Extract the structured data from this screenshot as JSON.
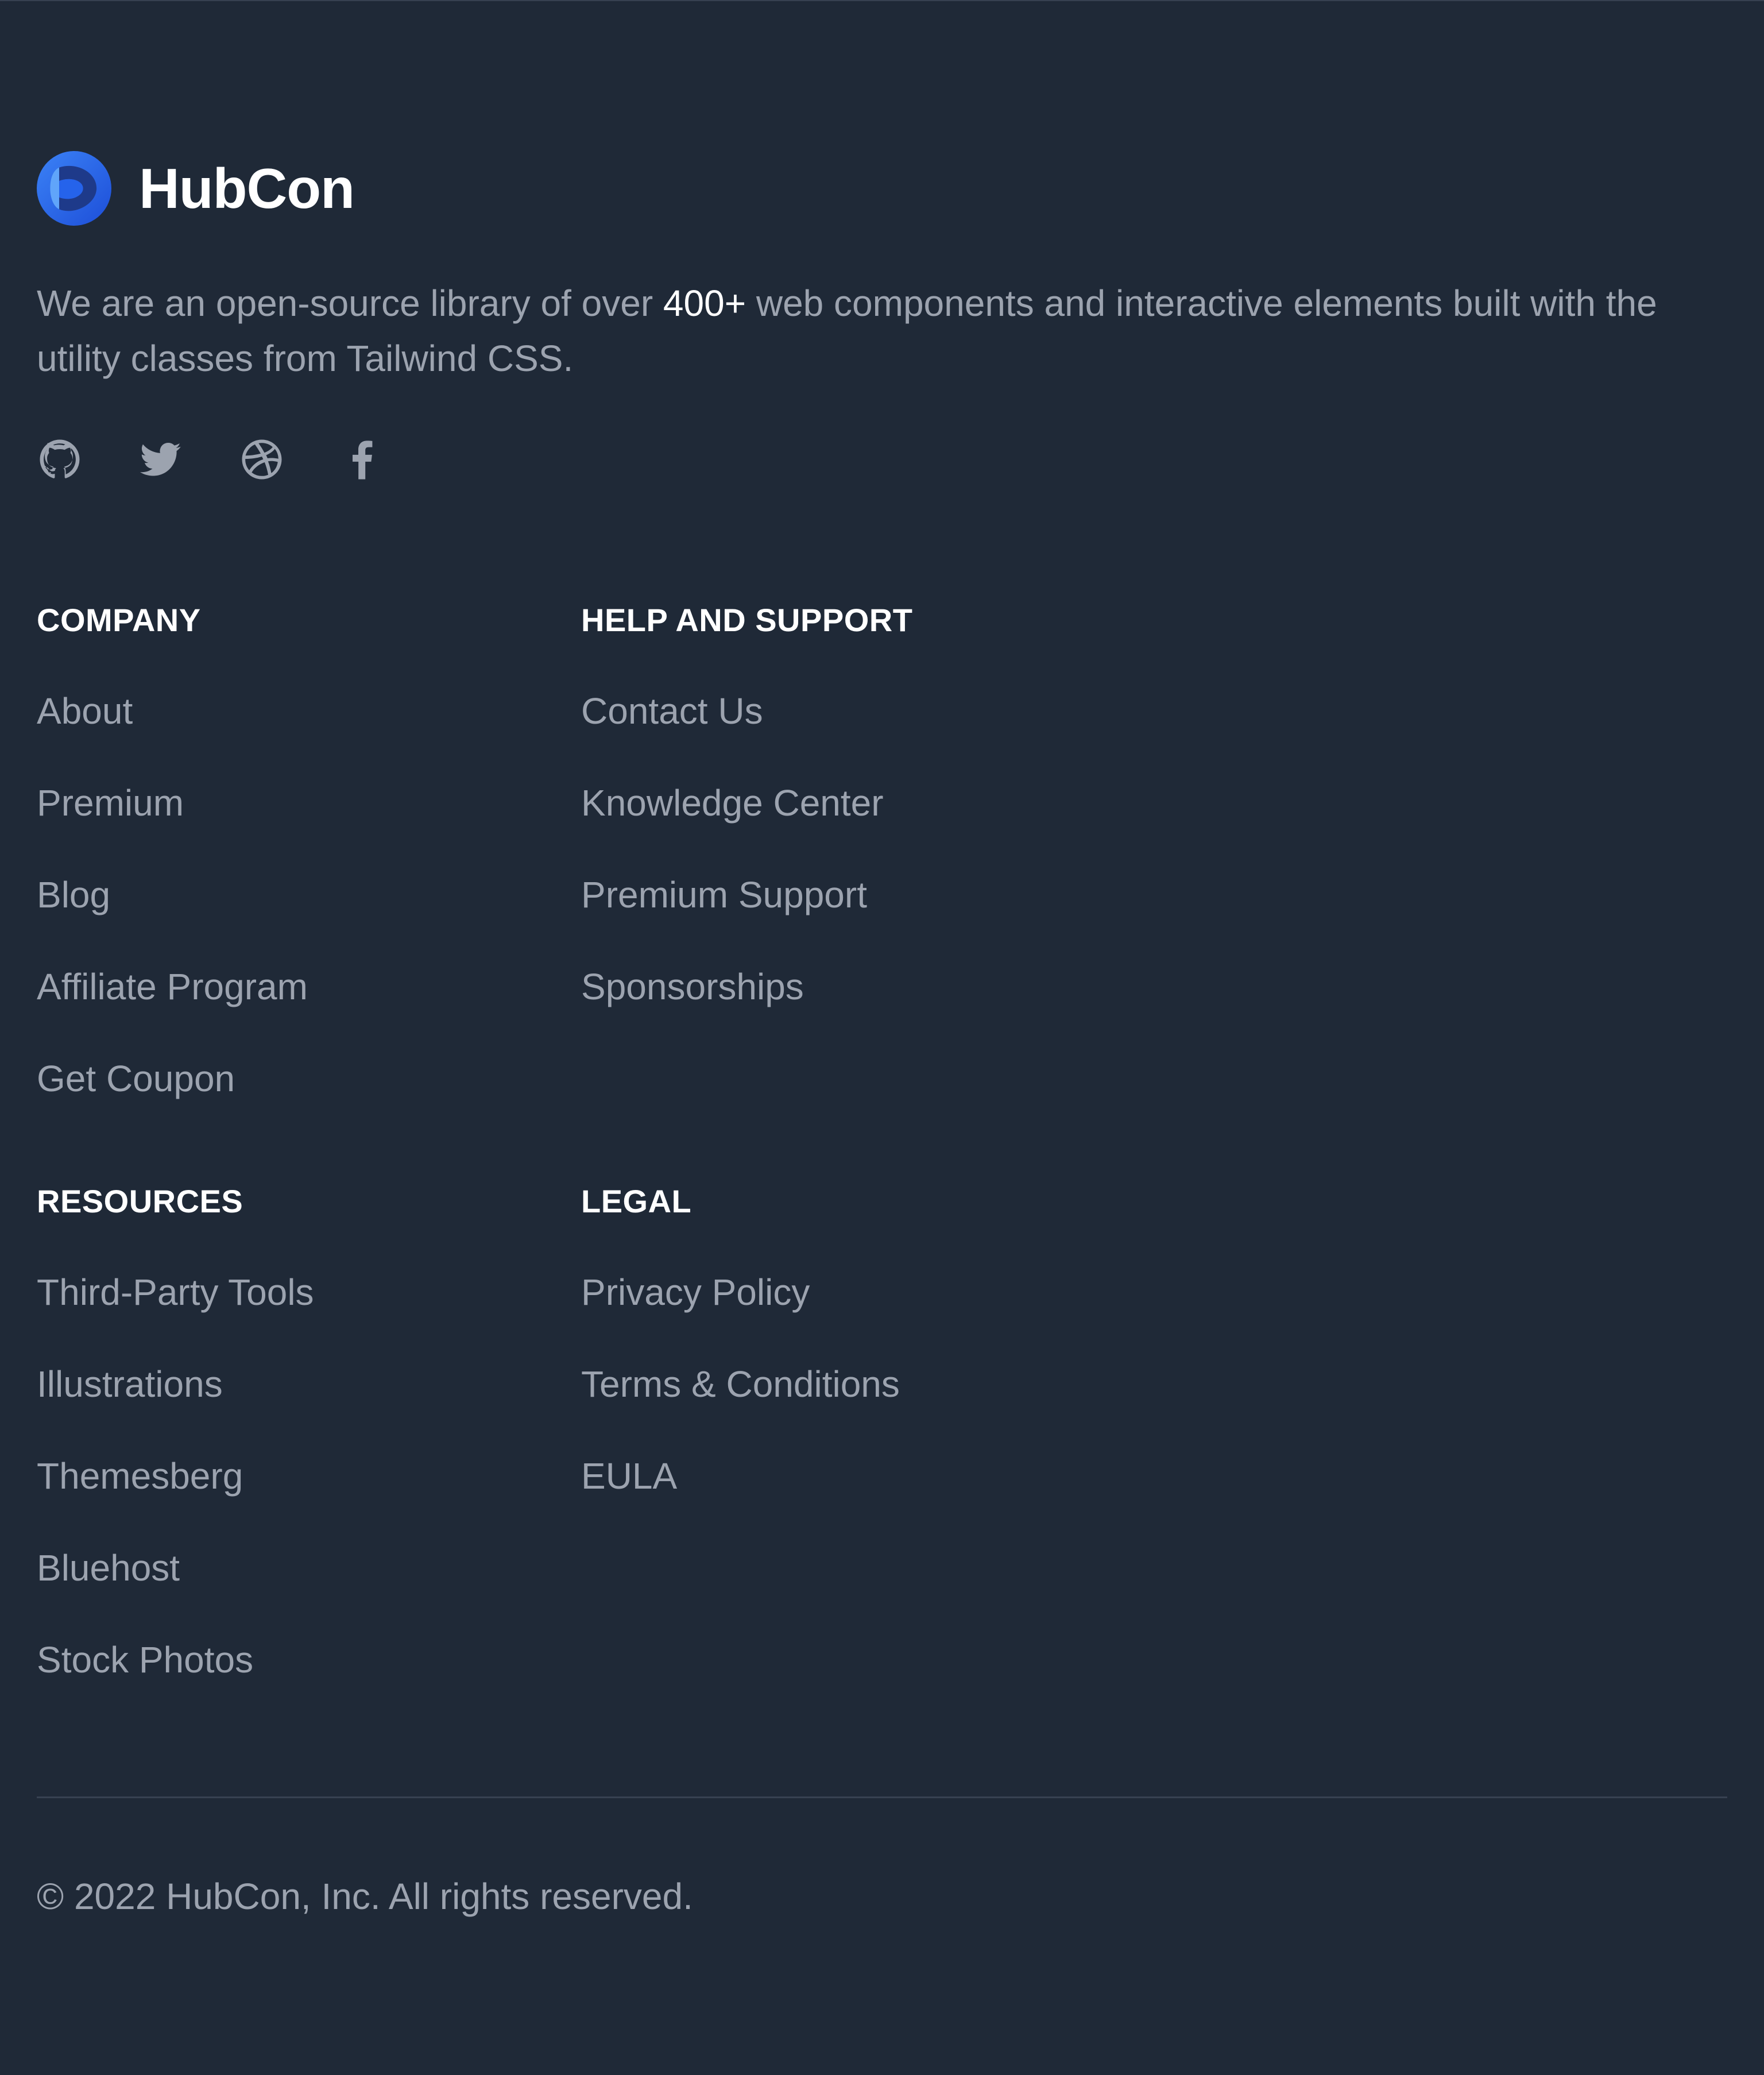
{
  "brand": {
    "name": "HubCon",
    "logo_colors": [
      "#1d4ed8",
      "#3b82f6",
      "#1e3a8a"
    ]
  },
  "tagline": {
    "before": "We are an open-source library of over ",
    "highlight": "400+",
    "after": " web components and interactive elements built with the utility classes from Tailwind CSS."
  },
  "socials": [
    {
      "icon": "github-icon"
    },
    {
      "icon": "twitter-icon"
    },
    {
      "icon": "dribbble-icon"
    },
    {
      "icon": "facebook-icon"
    }
  ],
  "sections": {
    "company": {
      "title": "COMPANY",
      "links": [
        "About",
        "Premium",
        "Blog",
        "Affiliate Program",
        "Get Coupon"
      ]
    },
    "help": {
      "title": "HELP AND SUPPORT",
      "links": [
        "Contact Us",
        "Knowledge Center",
        "Premium Support",
        "Sponsorships"
      ]
    },
    "resources": {
      "title": "RESOURCES",
      "links": [
        "Third-Party Tools",
        "Illustrations",
        "Themesberg",
        "Bluehost",
        "Stock Photos"
      ]
    },
    "legal": {
      "title": "LEGAL",
      "links": [
        "Privacy Policy",
        "Terms & Conditions",
        "EULA"
      ]
    }
  },
  "copyright": "© 2022 HubCon, Inc. All rights reserved.",
  "colors": {
    "background": "#1f2937",
    "heading": "#ffffff",
    "text": "#9ca3af",
    "divider": "#374151"
  }
}
